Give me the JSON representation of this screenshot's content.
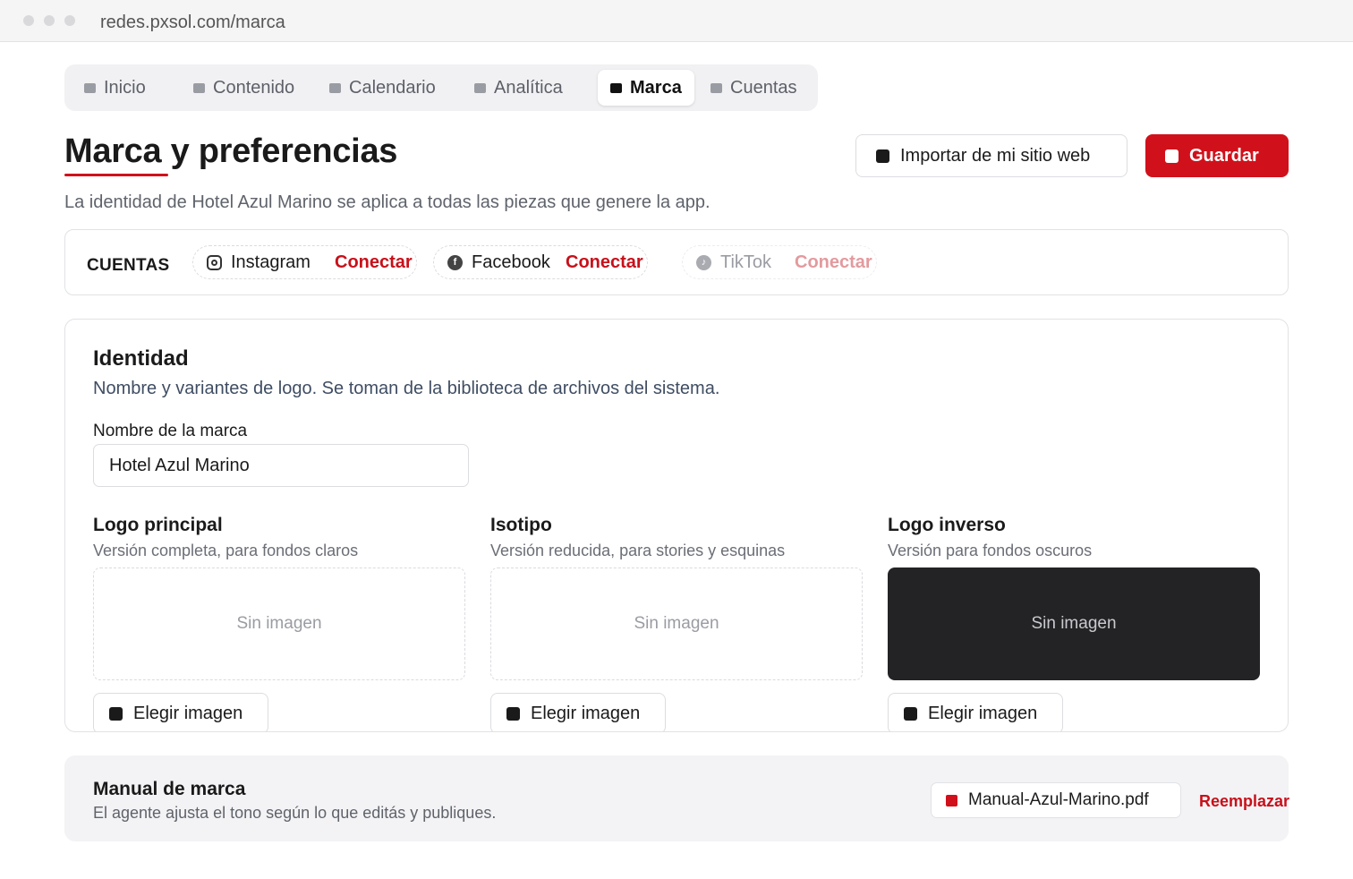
{
  "browser": {
    "url": "redes.pxsol.com/marca"
  },
  "nav": {
    "tabs": [
      {
        "label": "Inicio"
      },
      {
        "label": "Contenido"
      },
      {
        "label": "Calendario"
      },
      {
        "label": "Analítica"
      },
      {
        "label": "Marca",
        "active": true
      },
      {
        "label": "Cuentas"
      }
    ]
  },
  "header": {
    "title": "Marca y preferencias",
    "subtitle": "La identidad de Hotel Azul Marino se aplica a todas las piezas que genere la app.",
    "import_label": "Importar de mi sitio web",
    "save_label": "Guardar"
  },
  "accounts": {
    "label": "CUENTAS",
    "items": [
      {
        "name": "Instagram",
        "action": "Conectar",
        "icon": "instagram-icon"
      },
      {
        "name": "Facebook",
        "action": "Conectar",
        "icon": "facebook-icon"
      },
      {
        "name": "TikTok",
        "action": "Conectar",
        "icon": "tiktok-icon",
        "disabled": true
      }
    ]
  },
  "identity": {
    "title": "Identidad",
    "description": "Nombre y variantes de logo. Se toman de la biblioteca de archivos del sistema.",
    "brand_name_label": "Nombre de la marca",
    "brand_name_value": "Hotel Azul Marino",
    "logos": [
      {
        "title": "Logo principal",
        "subtitle": "Versión completa, para fondos claros",
        "empty": "Sin imagen",
        "button": "Elegir imagen"
      },
      {
        "title": "Isotipo",
        "subtitle": "Versión reducida, para stories y esquinas",
        "empty": "Sin imagen",
        "button": "Elegir imagen"
      },
      {
        "title": "Logo inverso",
        "subtitle": "Versión para fondos oscuros",
        "empty": "Sin imagen",
        "button": "Elegir imagen"
      }
    ]
  },
  "manual": {
    "title": "Manual de marca",
    "subtitle": "El agente ajusta el tono según lo que editás y publiques.",
    "file_name": "Manual-Azul-Marino.pdf",
    "replace_label": "Reemplazar"
  },
  "colors": {
    "accent": "#d0111b",
    "dark_logo_bg": "#232326"
  }
}
